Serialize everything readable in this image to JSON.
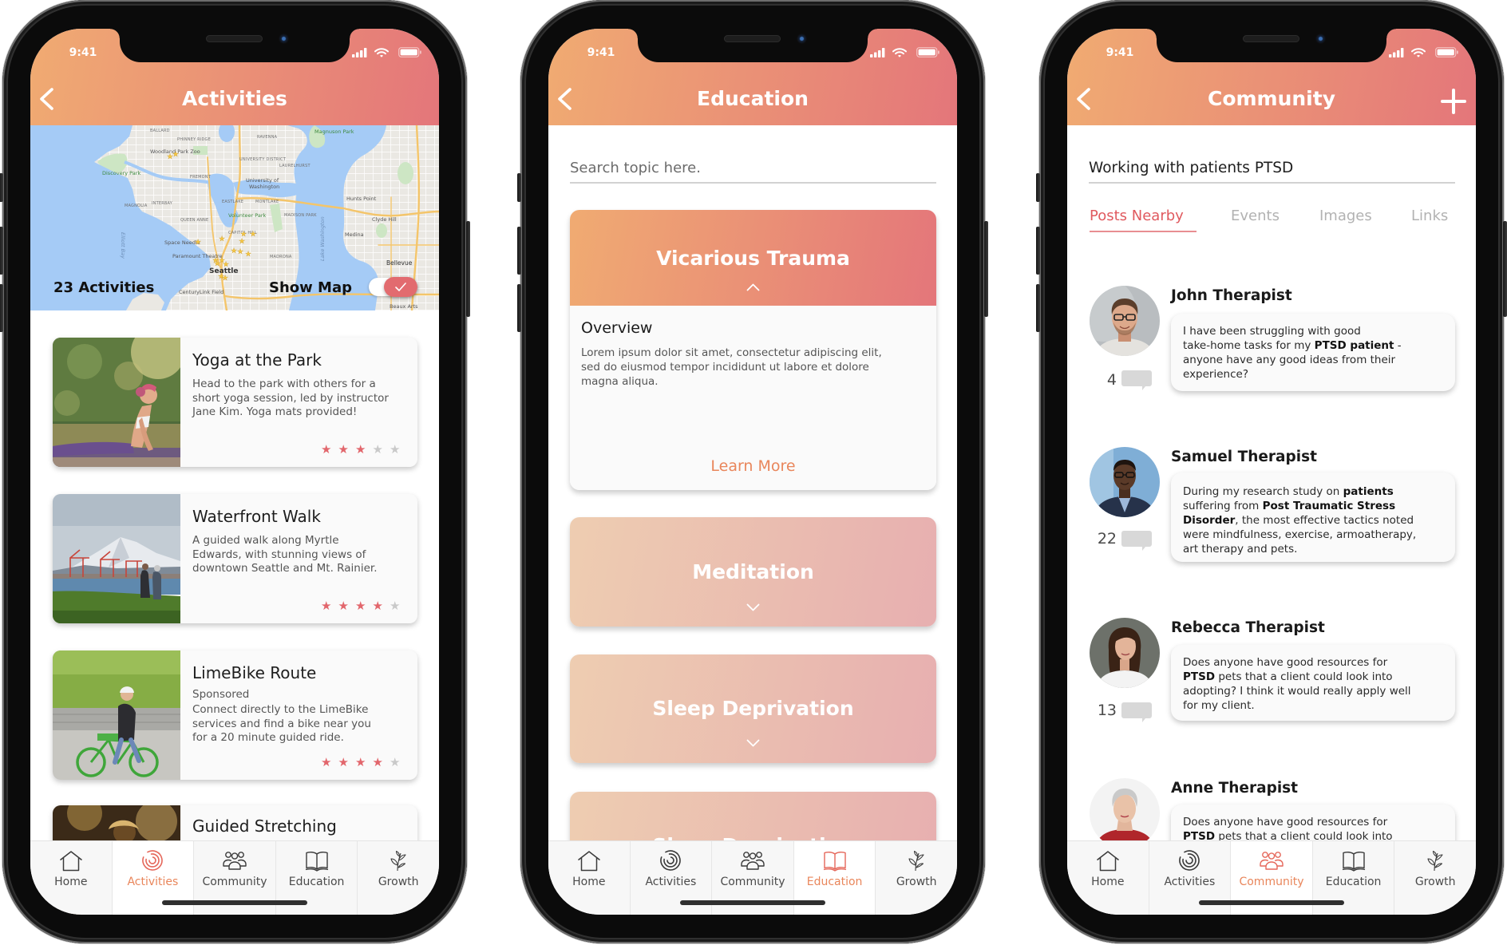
{
  "colors": {
    "header_gradient_start": "#F0AB72",
    "header_gradient_end": "#E4767A",
    "topic_light_start": "#EECDB1",
    "topic_light_end": "#E7AFB0",
    "accent": "#E9865B",
    "active_icon": "#E5675A",
    "tab_active_text": "#E05A5F",
    "star_filled": "#E2666C",
    "star_empty": "#C9C9C9",
    "toggle_on": "#E26B6F"
  },
  "status_bar": {
    "time": "9:41"
  },
  "tab_bar": {
    "items": [
      {
        "label": "Home",
        "icon": "home-icon"
      },
      {
        "label": "Activities",
        "icon": "activities-icon"
      },
      {
        "label": "Community",
        "icon": "community-icon"
      },
      {
        "label": "Education",
        "icon": "education-icon"
      },
      {
        "label": "Growth",
        "icon": "growth-icon"
      }
    ]
  },
  "activities_screen": {
    "title": "Activities",
    "active_tab": "Activities",
    "map": {
      "activity_count_label": "23 Activities",
      "show_map_label": "Show Map",
      "show_map_enabled": true,
      "labels": [
        "BALLARD",
        "PHINNEY RIDGE",
        "Woodland Park Zoo",
        "Discovery Park",
        "FREMONT",
        "University of",
        "Washington",
        "MAGNOLIA",
        "INTERBAY",
        "QUEEN ANNE",
        "Volunteer Park",
        "CAPITOL HILL",
        "Space Needle",
        "Paramount Theatre",
        "Seattle",
        "CenturyLink Field",
        "RAVENNA",
        "Magnuson Park",
        "Hunts Point",
        "Medina",
        "Bellevue",
        "Lake Washington",
        "Elliott Bay",
        "MADRONA",
        "Clyde Hill",
        "Beaux Arts",
        "UNIVERSITY DISTRICT",
        "LAURELHURST",
        "EASTLAKE",
        "MONTLAKE",
        "MADISON PARK"
      ]
    },
    "cards": [
      {
        "title": "Yoga at the Park",
        "description": "Head to the park with others for a\nshort yoga session, led by instructor\nJane Kim. Yoga mats provided!",
        "rating": 3,
        "max_rating": 5
      },
      {
        "title": "Waterfront Walk",
        "description": "A guided walk along Myrtle\nEdwards, with stunning views of\ndowntown Seattle and Mt. Rainier.",
        "rating": 4,
        "max_rating": 5
      },
      {
        "title": "LimeBike Route",
        "tag": "Sponsored",
        "description": "Connect directly to the LimeBike\nservices and find a bike near you\nfor a 20 minute guided ride.",
        "rating": 4,
        "max_rating": 5
      },
      {
        "title": "Guided Stretching"
      }
    ]
  },
  "education_screen": {
    "title": "Education",
    "active_tab": "Education",
    "search": {
      "placeholder": "Search topic here.",
      "value": ""
    },
    "topics": [
      {
        "title": "Vicarious Trauma",
        "expanded": true,
        "section_heading": "Overview",
        "body": "Lorem ipsum dolor sit amet, consectetur adipiscing elit,\nsed do eiusmod tempor incididunt ut labore et dolore\nmagna aliqua.",
        "link_label": "Learn More"
      },
      {
        "title": "Meditation",
        "expanded": false
      },
      {
        "title": "Sleep Deprivation",
        "expanded": false
      },
      {
        "title": "Sleep Deprivation",
        "expanded": false
      }
    ]
  },
  "community_screen": {
    "title": "Community",
    "active_tab": "Community",
    "topic_field": {
      "value": "Working with patients PTSD"
    },
    "tabs": [
      {
        "label": "Posts Nearby",
        "active": true
      },
      {
        "label": "Events",
        "active": false
      },
      {
        "label": "Images",
        "active": false
      },
      {
        "label": "Links",
        "active": false
      }
    ],
    "posts": [
      {
        "author": "John Therapist",
        "comment_count": 4,
        "text": [
          {
            "text": "I have been struggling with good\ntake-home tasks for my ",
            "bold": false
          },
          {
            "text": "PTSD patient",
            "bold": true
          },
          {
            "text": " -\nanyone have any good ideas from their\nexperience?",
            "bold": false
          }
        ]
      },
      {
        "author": "Samuel Therapist",
        "comment_count": 22,
        "text": [
          {
            "text": "During my research study on ",
            "bold": false
          },
          {
            "text": "patients",
            "bold": true
          },
          {
            "text": "\nsuffering from ",
            "bold": false
          },
          {
            "text": "Post Traumatic Stress\nDisorder",
            "bold": true
          },
          {
            "text": ", the most effective tactics noted\nwere mindfulness, exercise, armoatherapy,\nart therapy and pets.",
            "bold": false
          }
        ]
      },
      {
        "author": "Rebecca Therapist",
        "comment_count": 13,
        "text": [
          {
            "text": "Does anyone have good resources for\n",
            "bold": false
          },
          {
            "text": "PTSD",
            "bold": true
          },
          {
            "text": " pets that a client could look into\nadopting? I think it would really apply well\nfor my client.",
            "bold": false
          }
        ]
      },
      {
        "author": "Anne Therapist",
        "text": [
          {
            "text": "Does anyone have good resources for\n",
            "bold": false
          },
          {
            "text": "PTSD",
            "bold": true
          },
          {
            "text": " pets that a client could look into",
            "bold": false
          }
        ]
      }
    ]
  }
}
